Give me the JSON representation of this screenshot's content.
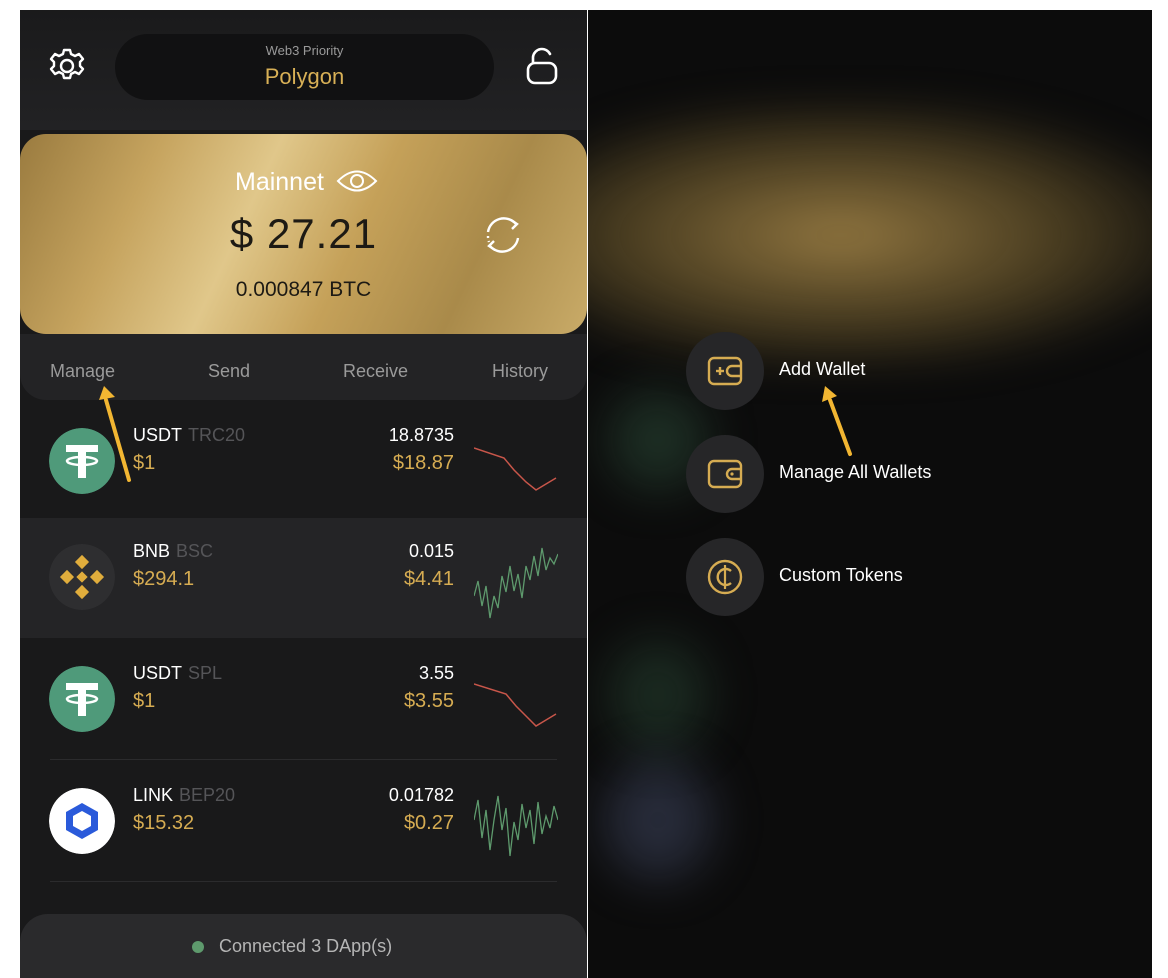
{
  "header": {
    "subtitle": "Web3 Priority",
    "network": "Polygon"
  },
  "card": {
    "network": "Mainnet",
    "balance": "$ 27.21",
    "btc": "0.000847 BTC"
  },
  "actions": [
    "Manage",
    "Send",
    "Receive",
    "History"
  ],
  "tokens": [
    {
      "symbol": "USDT",
      "chain": "TRC20",
      "price": "$1",
      "amount": "18.8735",
      "value": "$18.87",
      "trend": "down"
    },
    {
      "symbol": "BNB",
      "chain": "BSC",
      "price": "$294.1",
      "amount": "0.015",
      "value": "$4.41",
      "trend": "up"
    },
    {
      "symbol": "USDT",
      "chain": "SPL",
      "price": "$1",
      "amount": "3.55",
      "value": "$3.55",
      "trend": "down"
    },
    {
      "symbol": "LINK",
      "chain": "BEP20",
      "price": "$15.32",
      "amount": "0.01782",
      "value": "$0.27",
      "trend": "volatile"
    }
  ],
  "footer": {
    "status": "Connected 3 DApp(s)"
  },
  "menu": [
    {
      "label": "Add Wallet",
      "icon": "add-wallet-icon"
    },
    {
      "label": "Manage All Wallets",
      "icon": "wallet-icon"
    },
    {
      "label": "Custom Tokens",
      "icon": "coin-icon"
    }
  ],
  "colors": {
    "gold": "#d6ac52",
    "background": "#19191a",
    "up": "#5e9a6d",
    "down": "#c8564a",
    "annotation_arrow": "#f2b632"
  }
}
